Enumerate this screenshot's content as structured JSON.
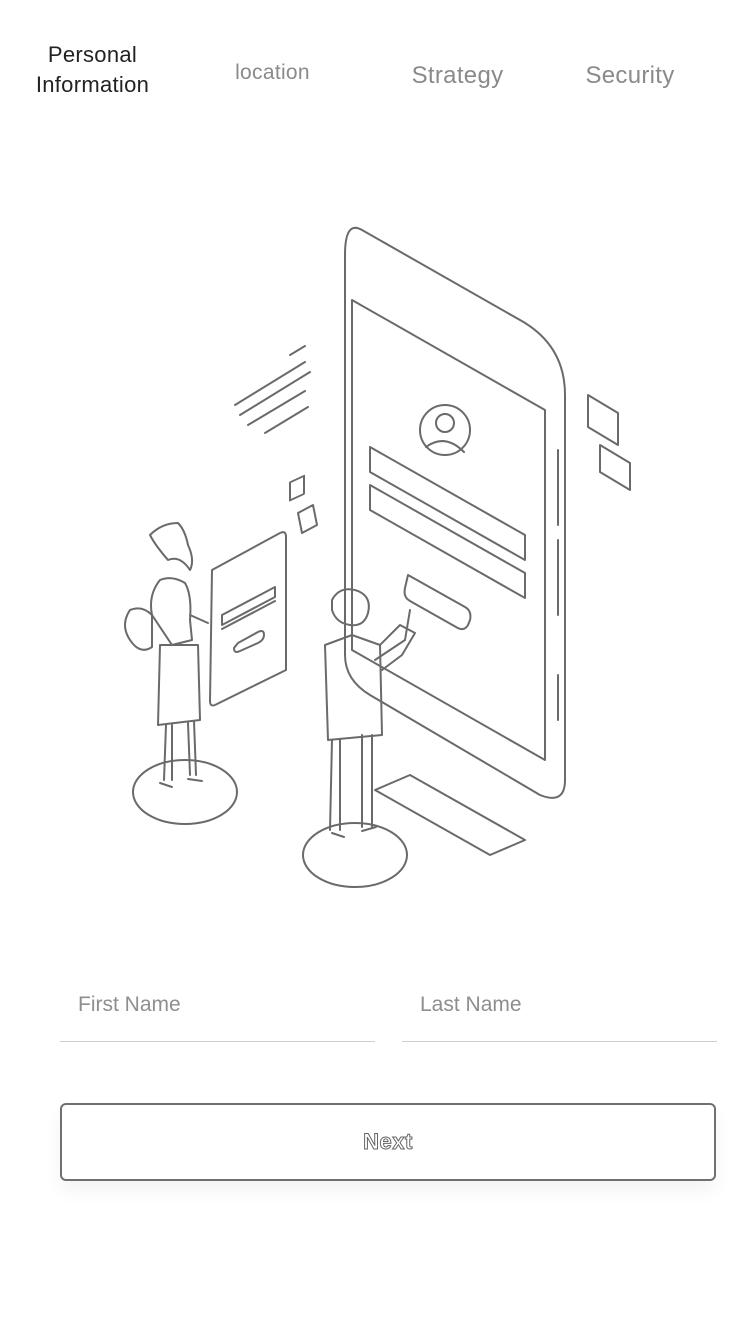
{
  "tabs": [
    {
      "label": "Personal\nInformation",
      "active": true
    },
    {
      "label": "location",
      "active": false
    },
    {
      "label": "Strategy",
      "active": false
    },
    {
      "label": "Security",
      "active": false
    }
  ],
  "form": {
    "first_name_placeholder": "First Name",
    "last_name_placeholder": "Last Name",
    "first_name_value": "",
    "last_name_value": ""
  },
  "actions": {
    "next_label": "Next"
  },
  "colors": {
    "line": "#6a6a6a",
    "text_active": "#222222",
    "text_inactive": "#8a8a8a",
    "divider": "#cfcfcf"
  }
}
